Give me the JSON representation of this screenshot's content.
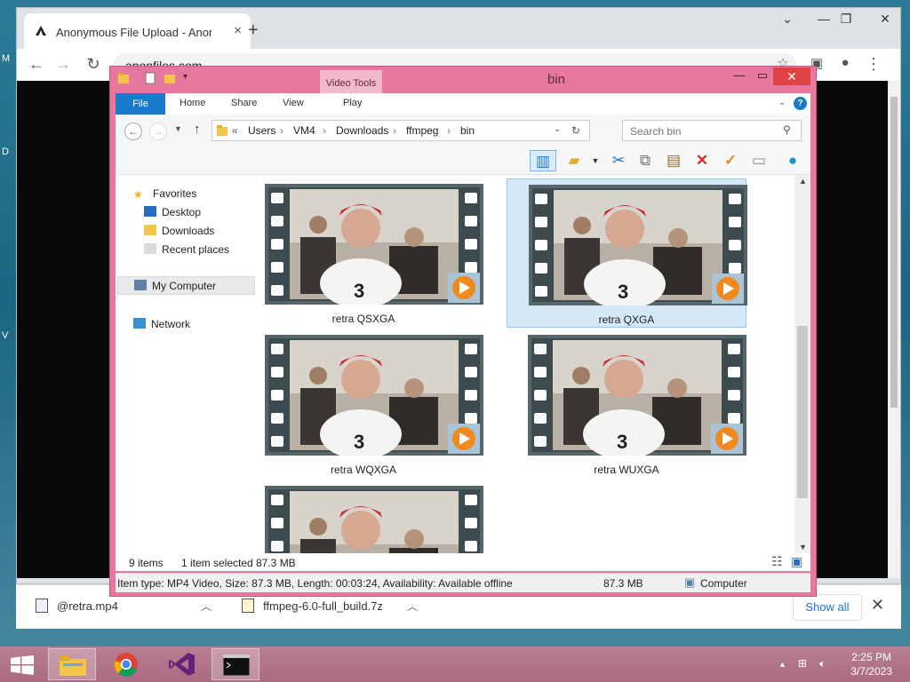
{
  "desktop": {
    "side_marks": [
      "M",
      "D",
      "V"
    ]
  },
  "chrome": {
    "tab_title": "Anonymous File Upload - AnonFiles",
    "tab_close": "×",
    "new_tab": "+",
    "url": "anonfiles.com",
    "downloads": [
      {
        "name": "@retra.mp4"
      },
      {
        "name": "ffmpeg-6.0-full_build.7z"
      }
    ],
    "show_all": "Show all"
  },
  "explorer": {
    "title": "bin",
    "contextual_tab": "Video Tools",
    "ribbon": {
      "file": "File",
      "home": "Home",
      "share": "Share",
      "view": "View",
      "play": "Play",
      "help": "?"
    },
    "address": {
      "prefix": "«",
      "crumbs": [
        "Users",
        "VM4",
        "Downloads",
        "ffmpeg",
        "bin"
      ]
    },
    "search_placeholder": "Search bin",
    "nav": {
      "favorites": "Favorites",
      "desktop": "Desktop",
      "downloads": "Downloads",
      "recent": "Recent places",
      "computer": "My Computer",
      "network": "Network"
    },
    "files": [
      {
        "name": "retra QSXGA",
        "selected": false
      },
      {
        "name": "retra QXGA",
        "selected": true
      },
      {
        "name": "retra WQXGA",
        "selected": false
      },
      {
        "name": "retra WUXGA",
        "selected": false
      },
      {
        "name": "",
        "selected": false
      }
    ],
    "status": {
      "count": "9 items",
      "selection": "1 item selected",
      "size": "87.3 MB"
    },
    "info": {
      "details": "Item type: MP4 Video, Size: 87.3 MB, Length: 00:03:24, Availability: Available offline",
      "size": "87.3 MB",
      "location": "Computer"
    }
  },
  "taskbar": {
    "time": "2:25 PM",
    "date": "3/7/2023"
  },
  "colors": {
    "explorer_frame": "#e8779f",
    "ribbon_file": "#1979ca",
    "selection": "#d5e8f8"
  }
}
